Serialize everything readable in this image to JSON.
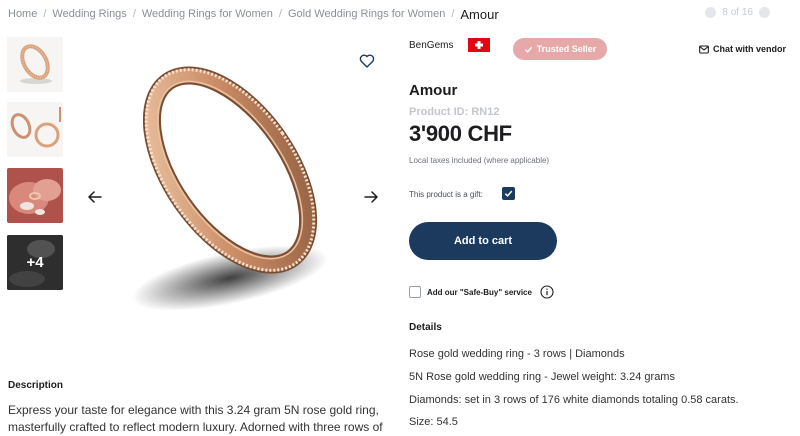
{
  "breadcrumb": {
    "items": [
      "Home",
      "Wedding Rings",
      "Wedding Rings for Women",
      "Gold Wedding Rings for Women"
    ],
    "current": "Amour",
    "separator": "/"
  },
  "pager": {
    "text": "8 of 16"
  },
  "thumbnails": {
    "more_label": "+4"
  },
  "vendor": {
    "name": "BenGems",
    "country_flag": "switzerland-flag-icon",
    "trusted_label": "Trusted Seller",
    "chat_label": "Chat with vendor"
  },
  "product": {
    "title": "Amour",
    "id_label": "Product ID: RN12",
    "price": "3'900 CHF",
    "taxes_note": "Local taxes included (where applicable)",
    "gift_label": "This product is a gift:",
    "gift_checked": true,
    "add_to_cart_label": "Add to cart",
    "safe_buy_label": "Add our \"Safe-Buy\" service"
  },
  "details": {
    "heading": "Details",
    "lines": [
      "Rose gold wedding ring - 3 rows | Diamonds",
      "5N Rose gold wedding ring - Jewel weight: 3.24 grams",
      "Diamonds: set in 3 rows of 176 white diamonds totaling 0.58 carats.",
      "Size: 54.5"
    ]
  },
  "description": {
    "heading": "Description",
    "text": "Express your taste for elegance with this 3.24 gram 5N rose gold ring, masterfully crafted to reflect modern luxury. Adorned with three rows of"
  },
  "colors": {
    "navy": "#1b3a5e",
    "trusted_pink": "#e6a8a8",
    "rose_gold": "#d9a27c"
  }
}
